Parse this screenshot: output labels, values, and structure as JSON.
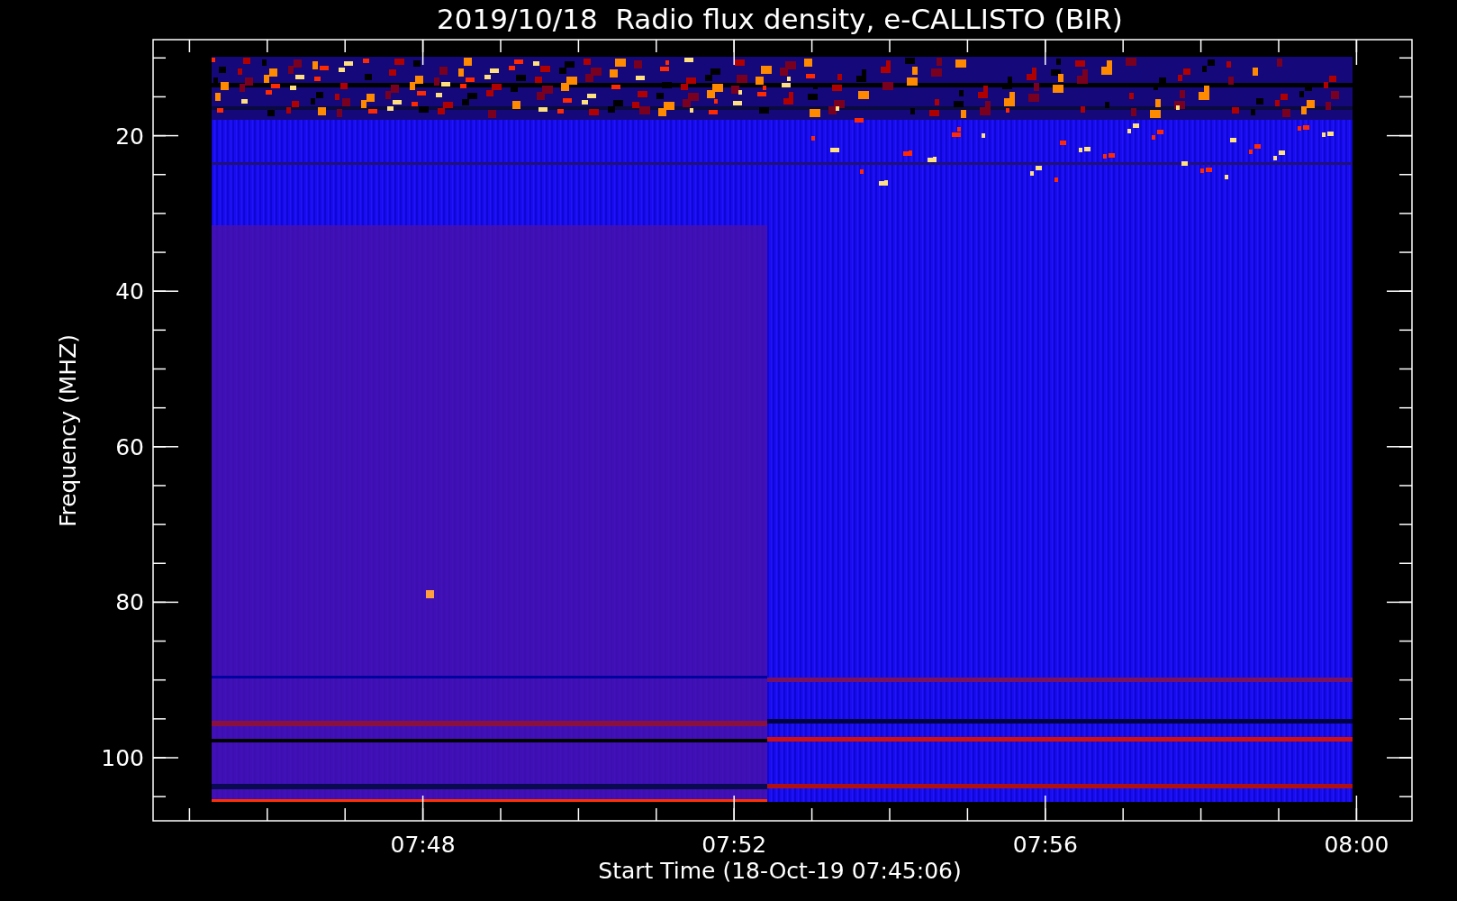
{
  "title": "2019/10/18  Radio flux density, e-CALLISTO (BIR)",
  "y_axis": {
    "label": "Frequency (MHZ)",
    "ticks": [
      "20",
      "40",
      "60",
      "80",
      "100"
    ]
  },
  "x_axis": {
    "label": "Start Time (18-Oct-19 07:45:06)",
    "ticks": [
      "07:48",
      "07:52",
      "07:56",
      "08:00"
    ]
  }
}
